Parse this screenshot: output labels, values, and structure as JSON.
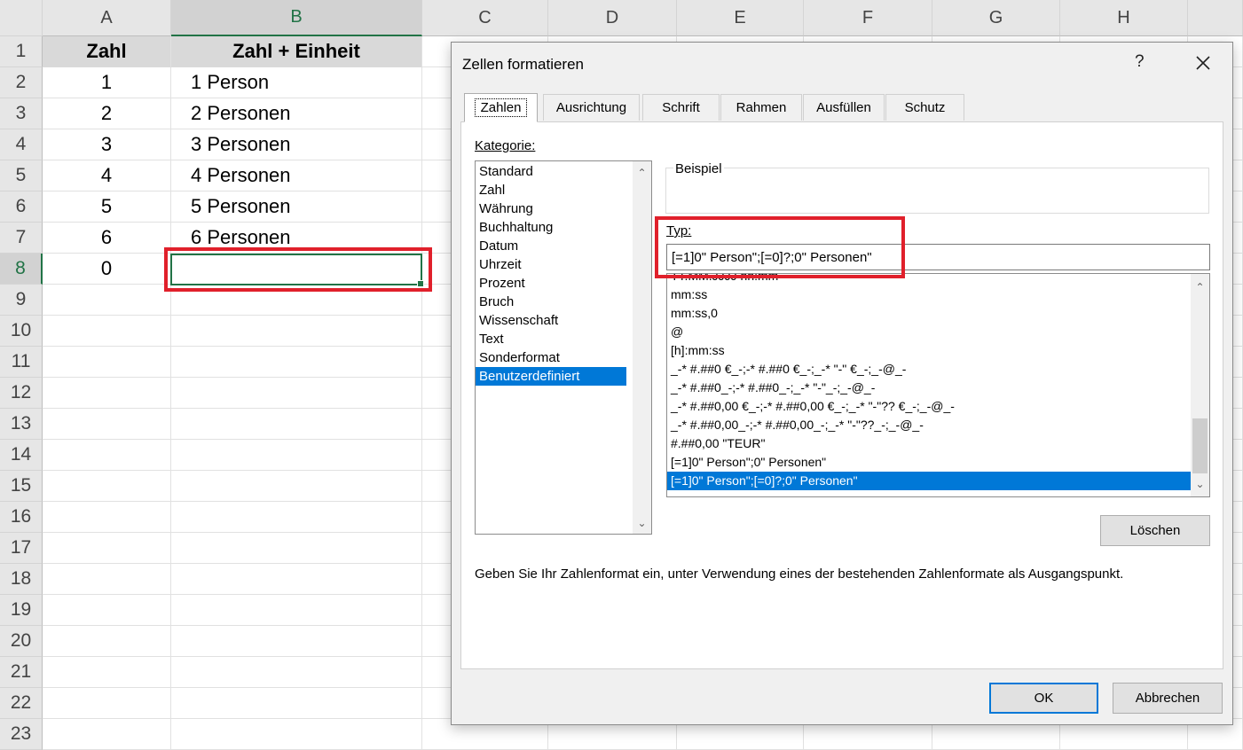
{
  "spreadsheet": {
    "columns": [
      "A",
      "B",
      "C",
      "D",
      "E",
      "F",
      "G",
      "H"
    ],
    "selected_column": "B",
    "rows": [
      "1",
      "2",
      "3",
      "4",
      "5",
      "6",
      "7",
      "8",
      "9",
      "10",
      "11",
      "12",
      "13",
      "14",
      "15",
      "16",
      "17",
      "18",
      "19",
      "20",
      "21",
      "22",
      "23"
    ],
    "selected_row": "8",
    "header_row": {
      "a": "Zahl",
      "b": "Zahl + Einheit"
    },
    "data_rows": [
      {
        "a": "1",
        "b": "1 Person"
      },
      {
        "a": "2",
        "b": "2 Personen"
      },
      {
        "a": "3",
        "b": "3 Personen"
      },
      {
        "a": "4",
        "b": "4 Personen"
      },
      {
        "a": "5",
        "b": "5 Personen"
      },
      {
        "a": "6",
        "b": "6 Personen"
      },
      {
        "a": "0",
        "b": ""
      }
    ],
    "header_fill_color": "#d9d9d9",
    "selection_color": "#217346",
    "highlight_color": "#e0202b"
  },
  "dialog": {
    "title": "Zellen formatieren",
    "help_label": "?",
    "close_icon": "close-icon",
    "tabs": [
      "Zahlen",
      "Ausrichtung",
      "Schrift",
      "Rahmen",
      "Ausfüllen",
      "Schutz"
    ],
    "active_tab": "Zahlen",
    "category_label": "Kategorie:",
    "categories": [
      "Standard",
      "Zahl",
      "Währung",
      "Buchhaltung",
      "Datum",
      "Uhrzeit",
      "Prozent",
      "Bruch",
      "Wissenschaft",
      "Text",
      "Sonderformat",
      "Benutzerdefiniert"
    ],
    "selected_category": "Benutzerdefiniert",
    "sample_label": "Beispiel",
    "sample_value": "",
    "type_label": "Typ:",
    "type_value": "[=1]0\" Person\";[=0]?;0\" Personen\"",
    "formats": [
      "TT.MM.JJJJ hh:mm",
      "mm:ss",
      "mm:ss,0",
      "@",
      "[h]:mm:ss",
      "_-* #.##0 €_-;-* #.##0 €_-;_-* \"-\" €_-;_-@_-",
      "_-* #.##0_-;-* #.##0_-;_-* \"-\"_-;_-@_-",
      "_-* #.##0,00 €_-;-* #.##0,00 €_-;_-* \"-\"?? €_-;_-@_-",
      "_-* #.##0,00_-;-* #.##0,00_-;_-* \"-\"??_-;_-@_-",
      "#.##0,00 \"TEUR\"",
      "[=1]0\" Person\";0\" Personen\"",
      "[=1]0\" Person\";[=0]?;0\" Personen\""
    ],
    "selected_format": "[=1]0\" Person\";[=0]?;0\" Personen\"",
    "delete_label": "Löschen",
    "hint": "Geben Sie Ihr Zahlenformat ein, unter Verwendung eines der bestehenden Zahlenformate als Ausgangspunkt.",
    "ok_label": "OK",
    "cancel_label": "Abbrechen",
    "accent_color": "#0078d7"
  }
}
